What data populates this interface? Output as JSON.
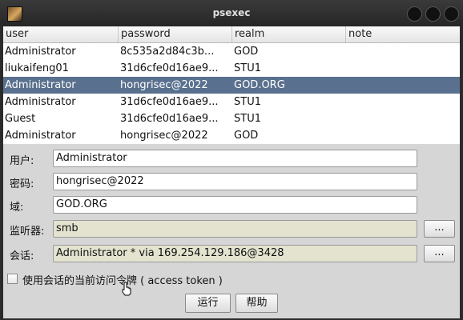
{
  "window": {
    "title": "psexec"
  },
  "table": {
    "columns": [
      "user",
      "password",
      "realm",
      "note"
    ],
    "rows": [
      {
        "user": "Administrator",
        "password": "8c535a2d84c3b...",
        "realm": "GOD",
        "note": ""
      },
      {
        "user": "liukaifeng01",
        "password": "31d6cfe0d16ae9...",
        "realm": "STU1",
        "note": ""
      },
      {
        "user": "Administrator",
        "password": "hongrisec@2022",
        "realm": "GOD.ORG",
        "note": "",
        "selected": true
      },
      {
        "user": "Administrator",
        "password": "31d6cfe0d16ae9...",
        "realm": "STU1",
        "note": ""
      },
      {
        "user": "Guest",
        "password": "31d6cfe0d16ae9...",
        "realm": "STU1",
        "note": ""
      },
      {
        "user": "Administrator",
        "password": "hongrisec@2022",
        "realm": "GOD",
        "note": ""
      }
    ]
  },
  "form": {
    "user_label": "用户:",
    "user_value": "Administrator",
    "password_label": "密码:",
    "password_value": "hongrisec@2022",
    "domain_label": "域:",
    "domain_value": "GOD.ORG",
    "listener_label": "监听器:",
    "listener_value": "smb",
    "session_label": "会话:",
    "session_value": "Administrator * via  169.254.129.186@3428",
    "browse_label": "...",
    "token_label": "使用会话的当前访问令牌 ( access token )",
    "token_checked": false
  },
  "buttons": {
    "run": "运行",
    "help": "帮助"
  }
}
